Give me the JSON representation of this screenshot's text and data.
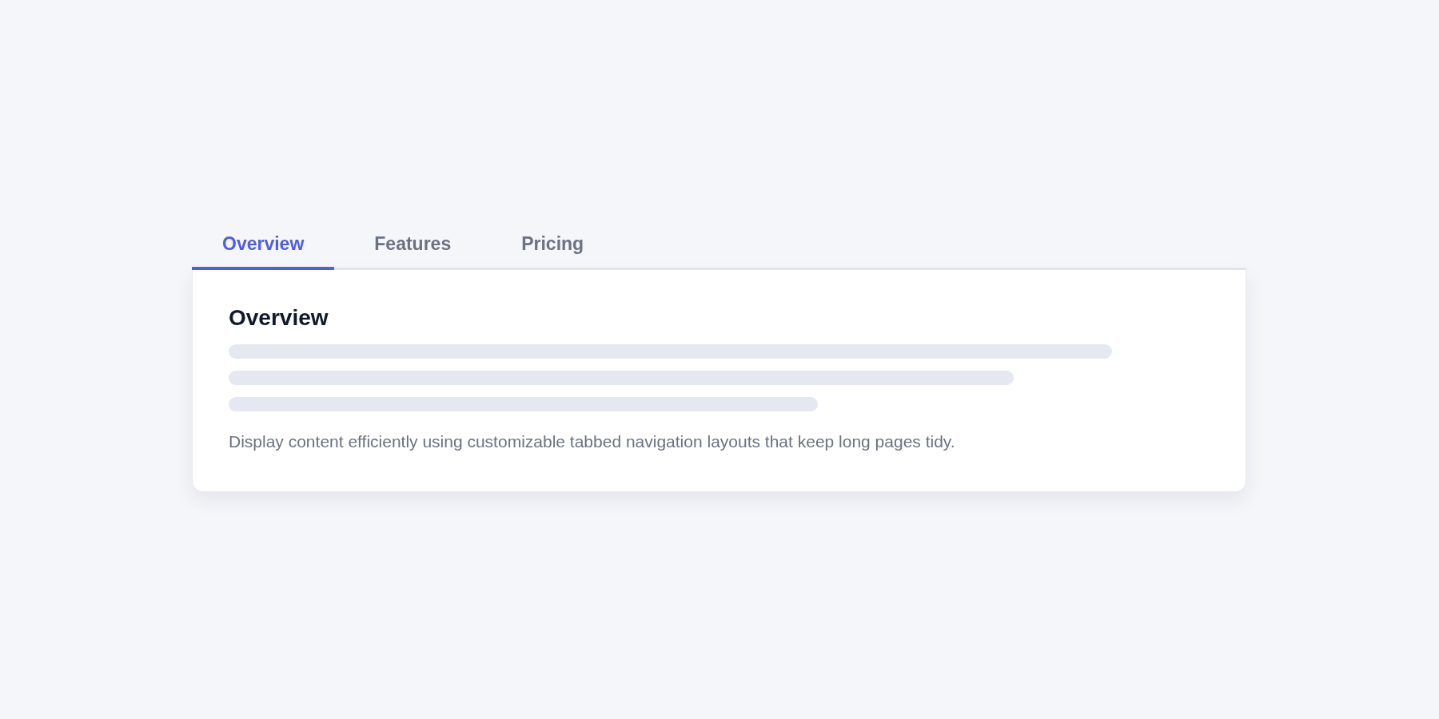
{
  "tabs": [
    {
      "label": "Overview",
      "selected": true
    },
    {
      "label": "Features",
      "selected": false
    },
    {
      "label": "Pricing",
      "selected": false
    }
  ],
  "panel": {
    "heading": "Overview",
    "description": "Display content efficiently using customizable tabbed navigation layouts that keep long pages tidy."
  }
}
